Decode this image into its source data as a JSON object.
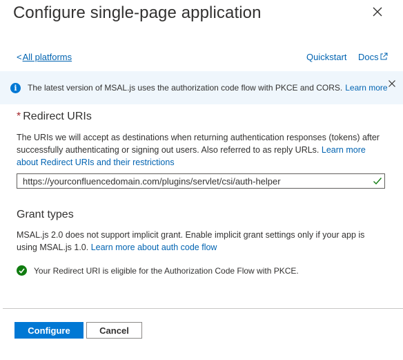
{
  "panel": {
    "title": "Configure single-page application"
  },
  "nav": {
    "back_chevron": "<",
    "back_label": "All platforms",
    "quickstart_label": "Quickstart",
    "docs_label": "Docs"
  },
  "info": {
    "icon": "info-icon",
    "message": "The latest version of MSAL.js uses the authorization code flow with PKCE and CORS.",
    "link_label": "Learn more"
  },
  "redirect": {
    "required_marker": "*",
    "label": "Redirect URIs",
    "description": "The URIs we will accept as destinations when returning authentication responses (tokens) after successfully authenticating or signing out users. Also referred to as reply URLs.",
    "link_label": "Learn more about Redirect URIs and their restrictions",
    "uri_value": "https://yourconfluencedomain.com/plugins/servlet/csi/auth-helper"
  },
  "grant": {
    "title": "Grant types",
    "description": "MSAL.js 2.0 does not support implicit grant. Enable implicit grant settings only if your app is using MSAL.js 1.0.",
    "link_label": "Learn more about auth code flow",
    "status_message": "Your Redirect URI is eligible for the Authorization Code Flow with PKCE."
  },
  "footer": {
    "primary_label": "Configure",
    "secondary_label": "Cancel"
  },
  "colors": {
    "accent": "#0078d4",
    "link": "#0063b1",
    "success": "#107c10",
    "info_bg": "#eff6fc",
    "required": "#a4262c"
  }
}
